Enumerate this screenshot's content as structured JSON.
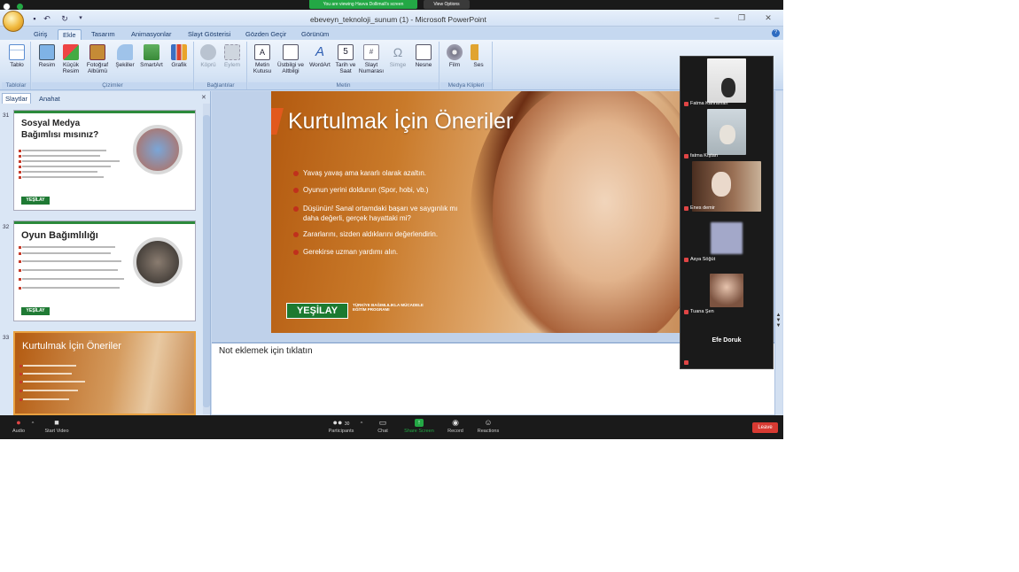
{
  "zoom": {
    "share_banner": "You are viewing Havva Dollimali's screen",
    "view_options": "View Options",
    "toolbar": [
      {
        "label": "Audio",
        "icon": "microphone-icon"
      },
      {
        "label": "Start Video",
        "icon": "video-camera-icon"
      },
      {
        "label": "Participants",
        "icon": "participants-icon",
        "count": "30"
      },
      {
        "label": "Chat",
        "icon": "chat-icon"
      },
      {
        "label": "Share Screen",
        "icon": "share-screen-icon"
      },
      {
        "label": "Record",
        "icon": "record-icon"
      },
      {
        "label": "Reactions",
        "icon": "reactions-icon"
      }
    ],
    "leave": "Leave",
    "participants": [
      {
        "name": "Fatma Kahraman"
      },
      {
        "name": "fatma Kıştan"
      },
      {
        "name": "Enes demir"
      },
      {
        "name": "Asya Söğüt"
      },
      {
        "name": "Tuana Şen"
      },
      {
        "name": "Efe Doruk"
      }
    ]
  },
  "window": {
    "title": "ebeveyn_teknoloji_sunum (1) - Microsoft PowerPoint"
  },
  "ribbon": {
    "tabs": [
      "Giriş",
      "Ekle",
      "Tasarım",
      "Animasyonlar",
      "Slayt Gösterisi",
      "Gözden Geçir",
      "Görünüm"
    ],
    "active_tab": "Ekle",
    "groups": [
      {
        "label": "Tablolar",
        "buttons": [
          "Tablo"
        ]
      },
      {
        "label": "Çizimler",
        "buttons": [
          "Resim",
          "Küçük Resim",
          "Fotoğraf Albümü",
          "Şekiller",
          "SmartArt",
          "Grafik"
        ]
      },
      {
        "label": "Bağlantılar",
        "buttons": [
          "Köprü",
          "Eylem"
        ]
      },
      {
        "label": "Metin",
        "buttons": [
          "Metin Kutusu",
          "Üstbilgi ve Altbilgi",
          "WordArt",
          "Tarih ve Saat",
          "Slayt Numarası",
          "Simge",
          "Nesne"
        ]
      },
      {
        "label": "Medya Klipleri",
        "buttons": [
          "Film",
          "Ses"
        ]
      }
    ]
  },
  "panel": {
    "tab_slides": "Slaytlar",
    "tab_outline": "Anahat",
    "thumbnails": [
      {
        "number": "31",
        "title": "Sosyal Medya Bağımlısı mısınız?"
      },
      {
        "number": "32",
        "title": "Oyun Bağımlılığı"
      },
      {
        "number": "33",
        "title": "Kurtulmak İçin Öneriler"
      }
    ],
    "thumb_logo": "YEŞİLAY"
  },
  "slide": {
    "title": "Kurtulmak İçin Öneriler",
    "bullets": [
      "Yavaş yavaş ama kararlı olarak azaltın.",
      "Oyunun yerini doldurun (Spor, hobi, vb.)",
      "Düşünün! Sanal ortamdaki başarı ve saygınlık mı daha değerli, gerçek hayattaki mi?",
      "Zararlarını, sizden aldıklarını değerlendirin.",
      "Gerekirse uzman yardımı alın."
    ],
    "logo": "YEŞİLAY",
    "logo_sub": "TÜRKİYE BAĞIMLILIKLA MÜCADELE EĞİTİM PROGRAMI"
  },
  "notes": {
    "placeholder": "Not eklemek için tıklatın"
  },
  "colors": {
    "zoom_green": "#23a845",
    "leave_red": "#d83a32",
    "yesilay_green": "#1c7a30",
    "bullet_red": "#c0301c"
  }
}
